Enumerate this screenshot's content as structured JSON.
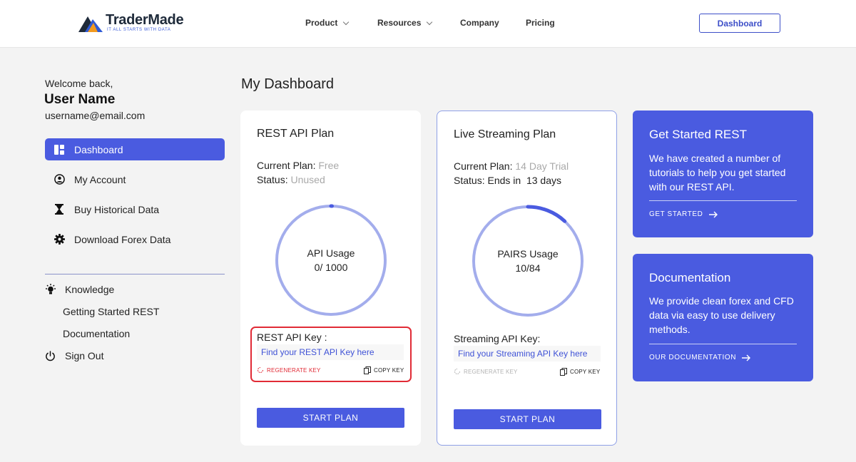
{
  "brand": {
    "name": "TraderMade",
    "tagline": "IT ALL STARTS WITH DATA"
  },
  "nav": {
    "items": [
      {
        "label": "Product",
        "has_menu": true
      },
      {
        "label": "Resources",
        "has_menu": true
      },
      {
        "label": "Company",
        "has_menu": false
      },
      {
        "label": "Pricing",
        "has_menu": false
      }
    ],
    "dashboard_button": "Dashboard"
  },
  "user": {
    "welcome": "Welcome back,",
    "name": "User Name",
    "email": "username@email.com"
  },
  "sidebar": {
    "items": [
      {
        "label": "Dashboard",
        "icon": "dashboard-icon",
        "active": true
      },
      {
        "label": "My Account",
        "icon": "account-icon",
        "active": false
      },
      {
        "label": "Buy Historical Data",
        "icon": "hourglass-icon",
        "active": false
      },
      {
        "label": "Download Forex Data",
        "icon": "gear-icon",
        "active": false
      }
    ],
    "knowledge": {
      "label": "Knowledge",
      "icon": "lightbulb-icon",
      "links": [
        "Getting Started REST",
        "Documentation"
      ]
    },
    "sign_out": {
      "label": "Sign Out",
      "icon": "power-icon"
    }
  },
  "main": {
    "title": "My Dashboard",
    "cards": [
      {
        "title": "REST API Plan",
        "plan_label": "Current Plan:",
        "plan_value": "Free",
        "status_label": "Status:",
        "status_value": "Unused",
        "gauge_label": "API Usage",
        "gauge_value": "0/ 1000",
        "gauge_fraction": 0.0,
        "key_label": "REST API Key :",
        "key_placeholder": "Find your REST API Key here",
        "regenerate": "REGENERATE KEY",
        "copy": "COPY KEY",
        "start": "START PLAN"
      },
      {
        "title": "Live Streaming Plan",
        "plan_label": "Current Plan:",
        "plan_value": "14 Day Trial",
        "status_label": "Status:",
        "status_value": "Ends in  13 days",
        "gauge_label": "PAIRS Usage",
        "gauge_value": "10/84",
        "gauge_fraction": 0.119,
        "key_label": "Streaming API Key:",
        "key_placeholder": "Find your Streaming API Key here",
        "regenerate": "REGENERATE KEY",
        "copy": "COPY KEY",
        "start": "START PLAN"
      }
    ],
    "info": [
      {
        "title": "Get Started REST",
        "text": "We have created a number of tutorials to help you get started with our REST API.",
        "link": "GET STARTED"
      },
      {
        "title": "Documentation",
        "text": "We provide clean forex and CFD data via easy to use delivery methods.",
        "link": "OUR DOCUMENTATION"
      }
    ]
  },
  "colors": {
    "accent": "#4a5be0",
    "gauge_track": "#a3adec",
    "gauge_fill": "#4a5be0",
    "alert": "#e12b36"
  }
}
